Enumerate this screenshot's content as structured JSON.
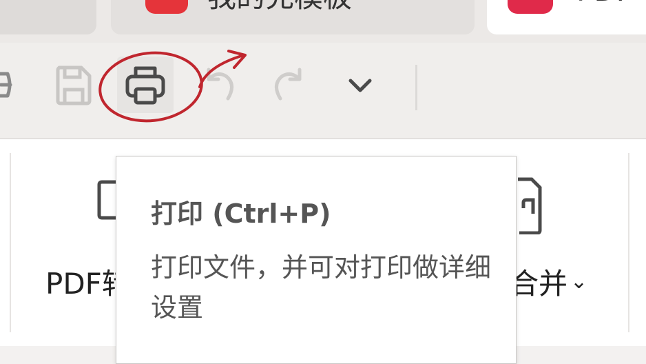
{
  "tabs": [
    {
      "label": ""
    },
    {
      "label": "我的充模板"
    },
    {
      "label": "PDF"
    }
  ],
  "toolbar": {
    "buttons": [
      {
        "icon": "save-as-icon"
      },
      {
        "icon": "save-icon"
      },
      {
        "icon": "printer-icon",
        "active": true
      },
      {
        "icon": "undo-icon"
      },
      {
        "icon": "redo-icon"
      },
      {
        "icon": "chevron-down-icon"
      }
    ]
  },
  "ribbon": {
    "left_label": "PDF转",
    "right_label": "合并",
    "right_dropdown_glyph": "⌄"
  },
  "tooltip": {
    "title": "打印 (Ctrl+P)",
    "description": "打印文件，并可对打印做详细设置"
  },
  "annotation": {
    "color": "#c0262e"
  }
}
